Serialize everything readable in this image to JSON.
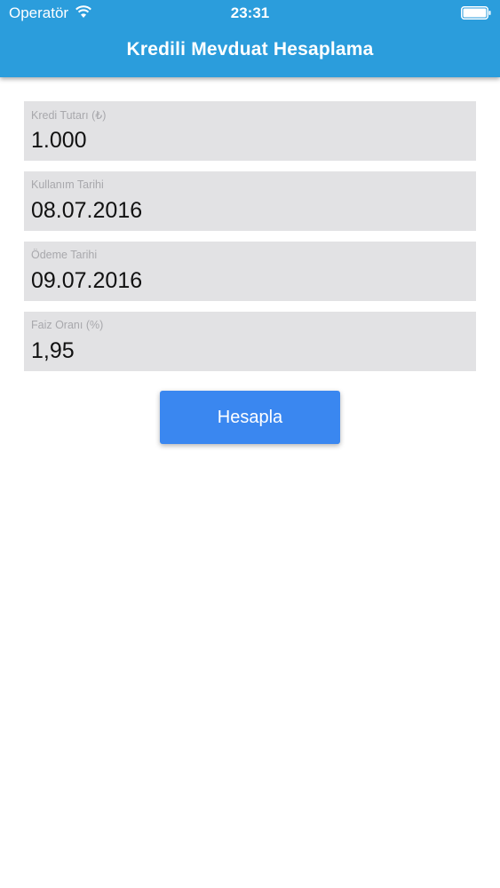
{
  "status_bar": {
    "carrier": "Operatör",
    "time": "23:31",
    "wifi_icon": "wifi-icon",
    "battery_icon": "battery-icon"
  },
  "header": {
    "title": "Kredili Mevduat Hesaplama",
    "color": "#2b9ddc"
  },
  "form": {
    "fields": [
      {
        "label": "Kredi Tutarı (₺)",
        "value": "1.000"
      },
      {
        "label": "Kullanım Tarihi",
        "value": "08.07.2016"
      },
      {
        "label": "Ödeme Tarihi",
        "value": "09.07.2016"
      },
      {
        "label": "Faiz Oranı (%)",
        "value": "1,95"
      }
    ]
  },
  "actions": {
    "calculate_label": "Hesapla",
    "button_color": "#3a87f0"
  }
}
